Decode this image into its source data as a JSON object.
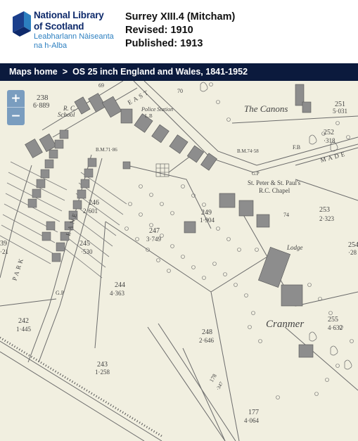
{
  "header": {
    "logo": {
      "line1": "National Library",
      "line2": "of Scotland",
      "line3": "Leabharlann Nàiseanta",
      "line4": "na h-Alba"
    },
    "sheet_title": "Surrey XIII.4 (Mitcham)",
    "revised": "Revised: 1910",
    "published": "Published: 1913"
  },
  "breadcrumb": {
    "home": "Maps home",
    "separator": ">",
    "series": "OS 25 inch England and Wales, 1841-1952"
  },
  "zoom": {
    "in_label": "+",
    "out_label": "−"
  },
  "map": {
    "labels": {
      "parcel_238": "238",
      "parcel_238_area": "6·889",
      "rc_school_1": "R. C.",
      "rc_school_2": "School",
      "police_station": "Police Station",
      "lb": "L.B",
      "east": "EAST",
      "canons": "The Canons",
      "parcel_251": "251",
      "parcel_251_area": "5·031",
      "parcel_252": "252",
      "parcel_252_area": "·318",
      "fb": "F.B",
      "bm_1": "B.M.71·86",
      "bm_2": "B.M.74·58",
      "gp_1": "G.P",
      "chapel_1": "St. Peter & St. Paul's",
      "chapel_2": "R.C. Chapel",
      "made": "MADE",
      "parcel_246": "246",
      "parcel_246_area": "2·601",
      "parcel_249": "249",
      "parcel_249_area": "1·904",
      "parcel_247": "247",
      "parcel_247_area": "3·749",
      "parcel_253": "253",
      "parcel_253_area": "2·323",
      "parcel_254": "254",
      "parcel_254_area": "·28",
      "lodge": "Lodge",
      "parcel_245": "245",
      "parcel_245_area": "·530",
      "parcel_39": "39",
      "parcel_21": "·21",
      "park": "PARK",
      "lane": "LANE",
      "parcel_244": "244",
      "parcel_244_area": "4·363",
      "gp_2": "G.P",
      "cranmer": "Cranmer",
      "parcel_255": "255",
      "parcel_255_area": "4·632",
      "parcel_242": "242",
      "parcel_242_area": "1·445",
      "parcel_248": "248",
      "parcel_248_area": "2·646",
      "parcel_243": "243",
      "parcel_243_area": "1·258",
      "parcel_178": "178",
      "parcel_178_area": "·347",
      "parcel_177": "177",
      "parcel_177_area": "4·064",
      "num_70": "70",
      "num_74": "74",
      "num_69": "69"
    }
  },
  "colors": {
    "brand_navy": "#0e2a6b",
    "brand_blue": "#2c7fc0",
    "breadcrumb_bg": "#0b1a3d",
    "map_paper": "#f1efe0",
    "zoom_bg": "#5282b4"
  }
}
